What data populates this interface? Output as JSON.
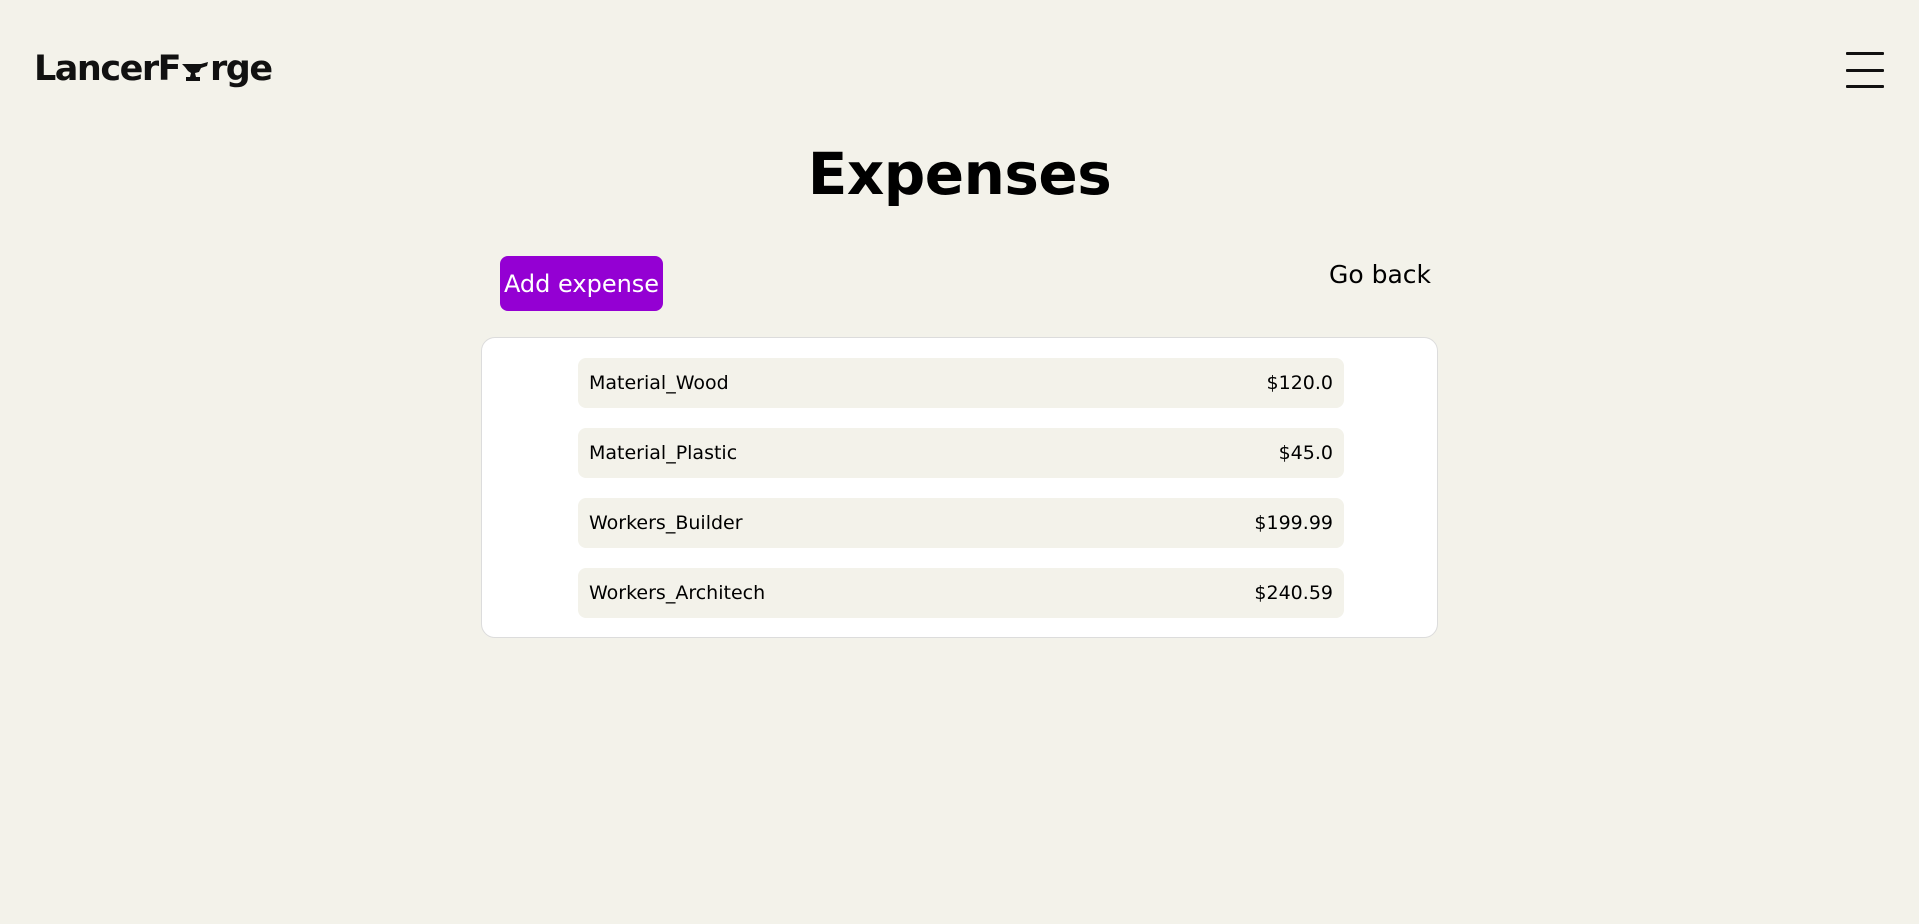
{
  "header": {
    "logo_left": "LancerF",
    "logo_right": "rge",
    "logo_icon": "anvil-icon",
    "menu_icon": "hamburger-menu-icon"
  },
  "main": {
    "title": "Expenses",
    "add_label": "Add expense",
    "back_label": "Go back",
    "accent_color": "#9400d3"
  },
  "expenses": [
    {
      "name": "Material_Wood",
      "amount": "$120.0"
    },
    {
      "name": "Material_Plastic",
      "amount": "$45.0"
    },
    {
      "name": "Workers_Builder",
      "amount": "$199.99"
    },
    {
      "name": "Workers_Architech",
      "amount": "$240.59"
    }
  ]
}
